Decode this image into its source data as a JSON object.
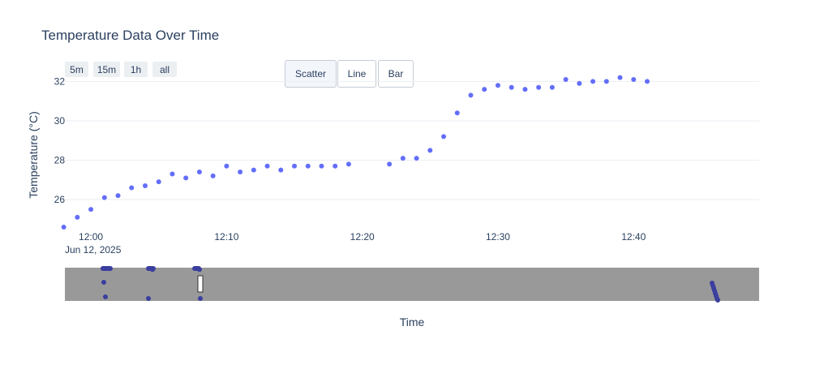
{
  "range_selector": {
    "buttons": [
      {
        "label": "5m"
      },
      {
        "label": "15m"
      },
      {
        "label": "1h"
      },
      {
        "label": "all"
      }
    ]
  },
  "chart_type_menu": {
    "buttons": [
      {
        "label": "Scatter",
        "active": true
      },
      {
        "label": "Line",
        "active": false
      },
      {
        "label": "Bar",
        "active": false
      }
    ]
  },
  "colors": {
    "marker": "#636efa",
    "rangeslider_bg": "#999999",
    "rangeslider_trace": "#3b3f9e",
    "grid": "#ebeef3"
  },
  "chart_data": {
    "type": "scatter",
    "title": "Temperature Data Over Time",
    "xlabel": "Time",
    "ylabel": "Temperature (°C)",
    "x_date_label": "Jun 12, 2025",
    "x_ticks": [
      {
        "time": "12:00",
        "label": "12:00"
      },
      {
        "time": "12:10",
        "label": "12:10"
      },
      {
        "time": "12:20",
        "label": "12:20"
      },
      {
        "time": "12:30",
        "label": "12:30"
      },
      {
        "time": "12:40",
        "label": "12:40"
      }
    ],
    "y_ticks": [
      26,
      28,
      30,
      32
    ],
    "xlim": [
      "11:58:05",
      "12:49:15"
    ],
    "ylim": [
      24.6,
      32.1
    ],
    "grid": true,
    "legend": "none",
    "series": [
      {
        "x": [
          "11:58",
          "11:59",
          "12:00",
          "12:01",
          "12:02",
          "12:03",
          "12:04",
          "12:05",
          "12:06",
          "12:07",
          "12:08",
          "12:09",
          "12:10",
          "12:11",
          "12:12",
          "12:13",
          "12:14",
          "12:15",
          "12:16",
          "12:17",
          "12:18",
          "12:19",
          "12:22",
          "12:23",
          "12:24",
          "12:25",
          "12:26",
          "12:27",
          "12:28",
          "12:29",
          "12:30",
          "12:31",
          "12:32",
          "12:33",
          "12:34",
          "12:35",
          "12:36",
          "12:37",
          "12:38",
          "12:39",
          "12:40",
          "12:41"
        ],
        "y": [
          24.6,
          25.1,
          25.5,
          26.1,
          26.2,
          26.6,
          26.7,
          26.9,
          27.3,
          27.1,
          27.4,
          27.2,
          27.7,
          27.4,
          27.5,
          27.7,
          27.5,
          27.7,
          27.7,
          27.7,
          27.7,
          27.8,
          27.8,
          28.1,
          28.1,
          28.5,
          29.2,
          30.4,
          31.3,
          31.6,
          31.8,
          31.7,
          31.6,
          31.7,
          31.7,
          32.1,
          31.9,
          32.0,
          32.0,
          32.2,
          32.1,
          32.0
        ]
      }
    ]
  }
}
